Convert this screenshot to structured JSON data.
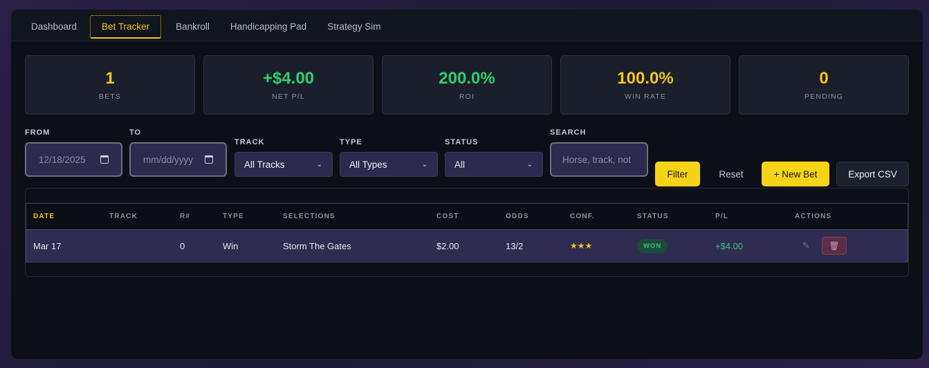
{
  "tabs": [
    {
      "label": "Dashboard",
      "active": false
    },
    {
      "label": "Bet Tracker",
      "active": true
    },
    {
      "label": "Bankroll",
      "active": false
    },
    {
      "label": "Handicapping Pad",
      "active": false
    },
    {
      "label": "Strategy Sim",
      "active": false
    }
  ],
  "stats": [
    {
      "value": "1",
      "label": "BETS",
      "color": "#f5c518"
    },
    {
      "value": "+$4.00",
      "label": "NET P/L",
      "color": "#2fd06a"
    },
    {
      "value": "200.0%",
      "label": "ROI",
      "color": "#2fd06a"
    },
    {
      "value": "100.0%",
      "label": "WIN RATE",
      "color": "#f5c518"
    },
    {
      "value": "0",
      "label": "PENDING",
      "color": "#f5c518"
    }
  ],
  "filters": {
    "from_label": "FROM",
    "from_value": "12/18/2025",
    "to_label": "TO",
    "to_placeholder": "mm/dd/yyyy",
    "track_label": "TRACK",
    "track_value": "All Tracks",
    "type_label": "TYPE",
    "type_value": "All Types",
    "status_label": "STATUS",
    "status_value": "All",
    "search_label": "SEARCH",
    "search_placeholder": "Horse, track, not",
    "filter_button": "Filter",
    "reset_button": "Reset",
    "new_bet_button": "+ New Bet",
    "export_button": "Export CSV"
  },
  "table": {
    "columns": [
      "DATE",
      "TRACK",
      "R#",
      "TYPE",
      "SELECTIONS",
      "COST",
      "ODDS",
      "CONF.",
      "STATUS",
      "P/L",
      "ACTIONS"
    ],
    "rows": [
      {
        "date": "Mar 17",
        "track": "",
        "race": "0",
        "type": "Win",
        "selections": "Storm The Gates",
        "cost": "$2.00",
        "odds": "13/2",
        "conf": "★★★",
        "status": "WON",
        "pl": "+$4.00",
        "edit_icon": "✎",
        "delete_icon": "🗑"
      }
    ]
  },
  "colors": {
    "accent": "#f5c518",
    "positive": "#2fd06a",
    "panel": "#0c0f16",
    "input": "#2d2a4f"
  }
}
